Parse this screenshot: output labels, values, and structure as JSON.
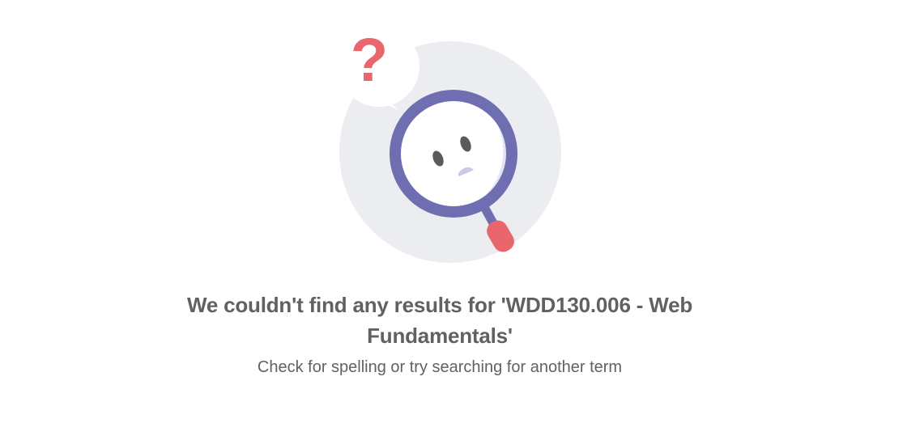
{
  "empty_state": {
    "illustration": {
      "icon": "magnifier-question-icon",
      "mark": "?"
    },
    "title": "We couldn't find any results for 'WDD130.006 - Web Fundamentals'",
    "subtitle": "Check for spelling or try searching for another term"
  },
  "colors": {
    "circle_bg": "#ecedf0",
    "magnifier": "#6e6eb0",
    "handle": "#e8676d",
    "question_mark": "#e8676d",
    "text": "#616161"
  }
}
